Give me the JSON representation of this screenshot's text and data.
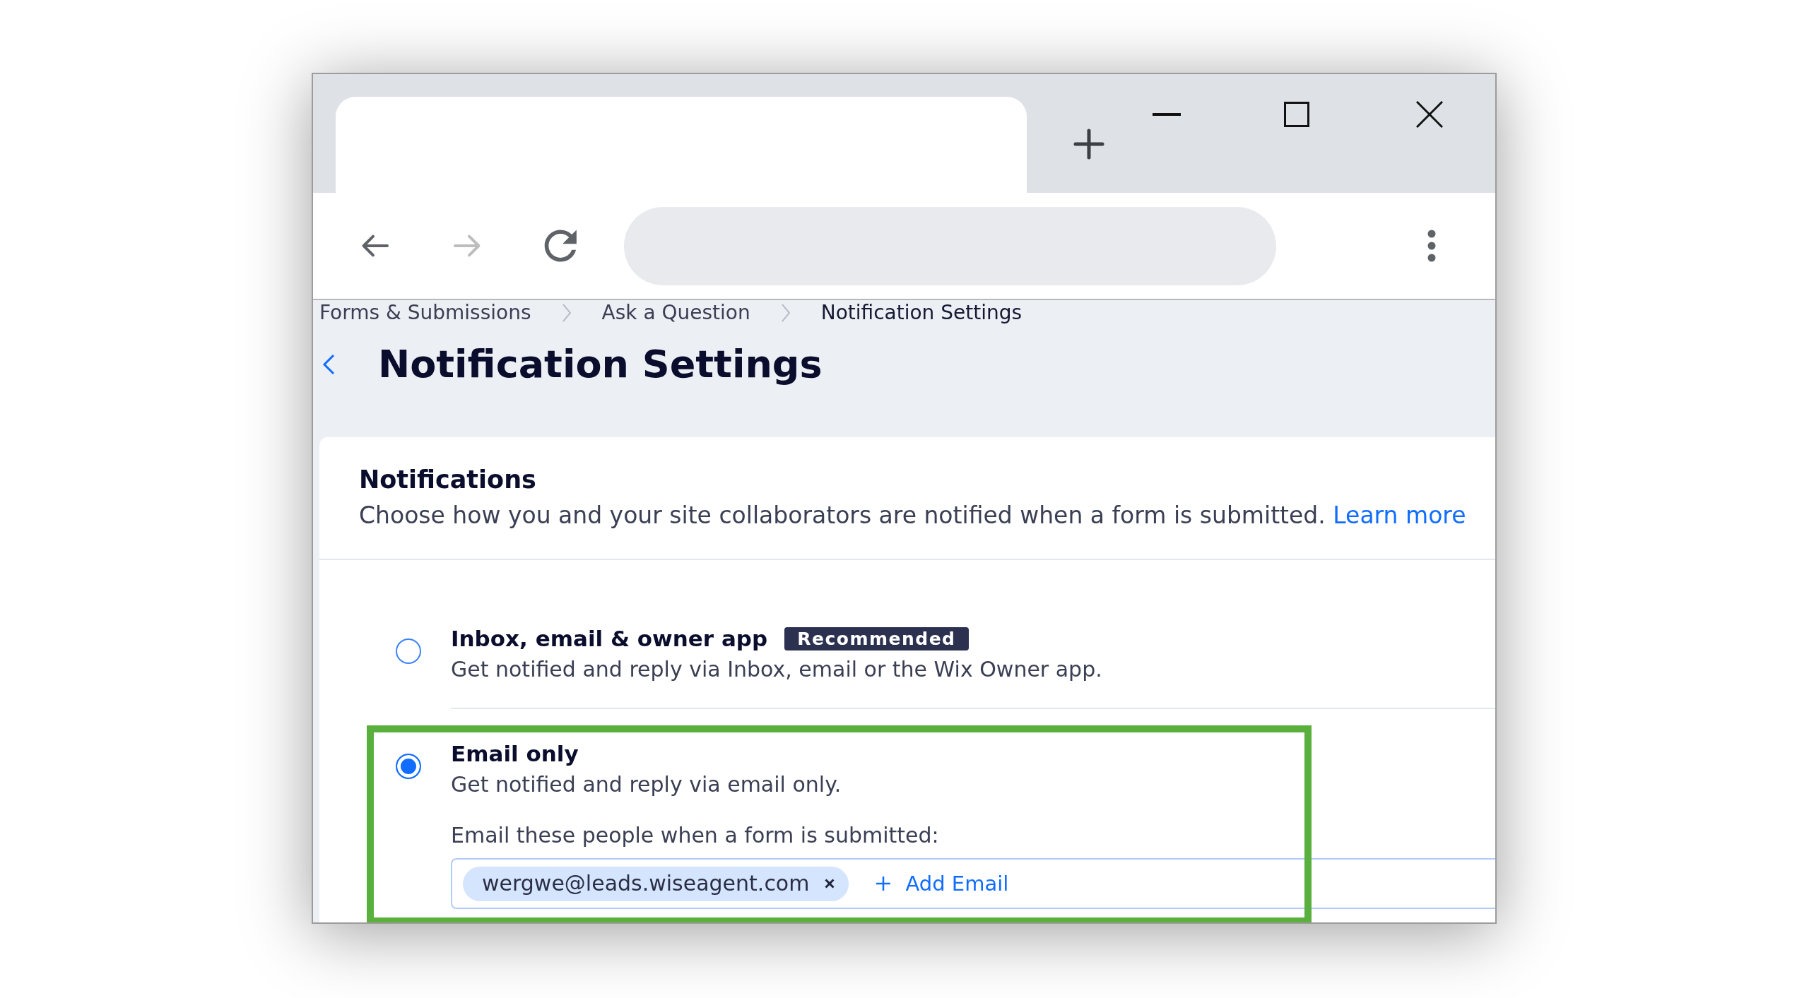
{
  "browser": {
    "tabs": [
      {
        "selected": true
      }
    ],
    "nav_buttons": [
      {
        "kind": "back",
        "disabled": false
      },
      {
        "kind": "forward",
        "disabled": true
      },
      {
        "kind": "reload",
        "disabled": false
      }
    ]
  },
  "breadcrumbs": [
    {
      "label": "Forms & Submissions",
      "current": false
    },
    {
      "label": "Ask a Question",
      "current": false
    },
    {
      "label": "Notification Settings",
      "current": true
    }
  ],
  "page_title": "Notification Settings",
  "section": {
    "title": "Notifications",
    "description": "Choose how you and your site collaborators are notified when a form is submitted.",
    "link": "Learn more"
  },
  "options": [
    {
      "title": "Inbox, email & owner app",
      "badge": "Recommended",
      "description": "Get notified and reply via Inbox, email or the Wix Owner app.",
      "selected": false,
      "highlighted": false
    },
    {
      "title": "Email only",
      "description": "Get notified and reply via email only.",
      "selected": true,
      "highlighted": true,
      "recipients": {
        "label": "Email these people when a form is submitted:",
        "emails": [
          "wergwe@leads.wiseagent.com"
        ],
        "add_button": "Add Email"
      }
    }
  ]
}
